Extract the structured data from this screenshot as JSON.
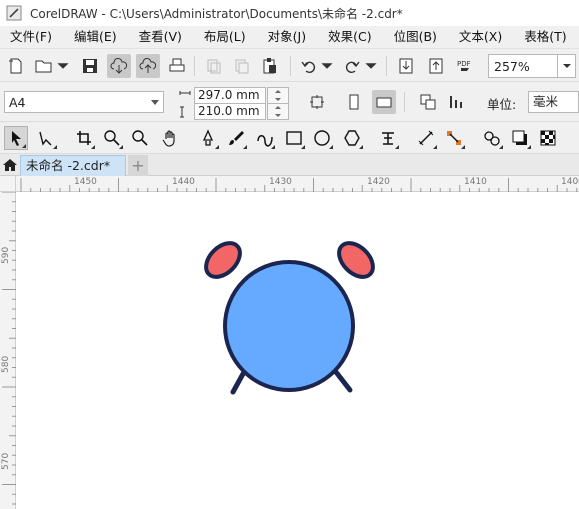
{
  "window": {
    "title": "CorelDRAW - C:\\Users\\Administrator\\Documents\\未命名 -2.cdr*"
  },
  "menu": [
    "文件(F)",
    "编辑(E)",
    "查看(V)",
    "布局(L)",
    "对象(J)",
    "效果(C)",
    "位图(B)",
    "文本(X)",
    "表格(T)"
  ],
  "toolbar": {
    "zoom": "257%"
  },
  "property_bar": {
    "page_size": "A4",
    "width": "297.0 mm",
    "height": "210.0 mm",
    "units_label": "单位:",
    "units_value": "毫米"
  },
  "tabs": {
    "document": "未命名 -2.cdr*"
  },
  "rulers": {
    "horizontal": [
      "1450",
      "1440",
      "1430",
      "1420",
      "1410",
      "1400"
    ],
    "vertical": [
      "590",
      "580",
      "570"
    ]
  },
  "icons": {
    "new": "new-document-icon",
    "open": "open-folder-icon",
    "save": "save-icon",
    "cloud_download": "cloud-download-icon",
    "cloud_upload": "cloud-upload-icon",
    "print": "print-icon",
    "undo": "undo-icon",
    "redo": "redo-icon",
    "import": "import-icon",
    "export": "export-icon",
    "pdf": "pdf-icon"
  },
  "drawing": {
    "description_colors": {
      "body_fill": "#66aaff",
      "bell_fill": "#f26666",
      "outline": "#1a2550"
    }
  }
}
